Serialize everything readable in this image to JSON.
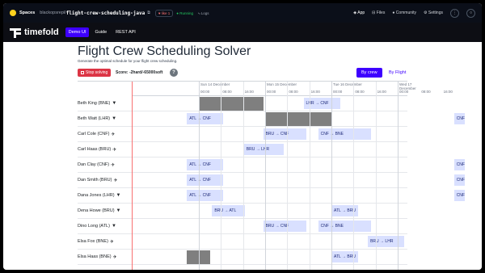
{
  "hf": {
    "spaces": "Spaces",
    "owner": "blackopsrepl/",
    "repo": "flight-crew-scheduling-java",
    "like": "♥ like 1",
    "status": "● Running",
    "logs": "⤷ Logs",
    "nav": [
      "App",
      "Files",
      "Community",
      "Settings"
    ]
  },
  "timefold": {
    "brand": "timefold",
    "nav": [
      "Demo UI",
      "Guide",
      "REST API"
    ]
  },
  "page": {
    "title": "Flight Crew Scheduling Solver",
    "subtitle": "Generate the optimal schedule for your flight crew scheduling.",
    "stop_label": "Stop solving",
    "score": "Score: -2hard/-65000soft",
    "info": "?",
    "by_crew": "By crew",
    "by_flight": "By Flight"
  },
  "timeline": {
    "days": [
      "Sun 14 December",
      "Mon 15 December",
      "Tue 16 December",
      "Wed 17 December"
    ],
    "hours": [
      "00:00",
      "08:00",
      "16:00",
      "00:00",
      "08:00",
      "16:00",
      "00:00",
      "08:00",
      "16:00",
      "00:00",
      "08:00",
      "16:00"
    ],
    "rows": [
      {
        "name": "Beth King (BNE)",
        "icon": "pilot-icon",
        "grays": [
          [
            0.0,
            0.97
          ]
        ],
        "flights": [
          [
            1.58,
            0.55,
            "LHR → CNF"
          ]
        ]
      },
      {
        "name": "Beth Watt (LHR)",
        "icon": "pilot-icon",
        "grays": [
          [
            1.0,
            2.0
          ]
        ],
        "flights": [
          [
            -0.18,
            0.55,
            "ATL → CNF"
          ],
          [
            3.85,
            0.55,
            "CNF"
          ]
        ]
      },
      {
        "name": "Carl Cole (CNF)",
        "icon": "attendant-icon",
        "grays": [],
        "flights": [
          [
            0.97,
            0.65,
            "BRU → CNF"
          ],
          [
            1.8,
            0.8,
            "CNF → BNE"
          ]
        ]
      },
      {
        "name": "Carl Haas (BRU)",
        "icon": "attendant-icon",
        "grays": [],
        "flights": [
          [
            0.68,
            0.6,
            "BRU → LHR"
          ]
        ]
      },
      {
        "name": "Dan Clay (CNF)",
        "icon": "attendant-icon",
        "grays": [],
        "flights": [
          [
            -0.18,
            0.55,
            "ATL → CNF"
          ],
          [
            3.85,
            0.55,
            "CNF"
          ]
        ]
      },
      {
        "name": "Dan Smith (BRU)",
        "icon": "attendant-icon",
        "grays": [],
        "flights": [
          [
            -0.18,
            0.55,
            "ATL → CNF"
          ],
          [
            3.85,
            0.55,
            "CNF"
          ]
        ]
      },
      {
        "name": "Dana Jones (LHR)",
        "icon": "pilot-icon",
        "grays": [],
        "flights": [
          [
            -0.18,
            0.55,
            "ATL → CNF"
          ],
          [
            3.85,
            0.55,
            "CNF"
          ]
        ]
      },
      {
        "name": "Dena Howe (BRU)",
        "icon": "pilot-icon",
        "grays": [],
        "flights": [
          [
            0.2,
            0.5,
            "BRU → ATL"
          ],
          [
            2.0,
            0.4,
            "ATL → BRU"
          ]
        ]
      },
      {
        "name": "Dino Long (ATL)",
        "icon": "pilot-icon",
        "grays": [],
        "flights": [
          [
            0.97,
            0.65,
            "BRU → CNF"
          ],
          [
            1.8,
            0.8,
            "CNF → BNE"
          ]
        ]
      },
      {
        "name": "Elsa Fox (BNE)",
        "icon": "attendant-icon",
        "grays": [],
        "flights": [
          [
            2.55,
            0.55,
            "BRU → LHR"
          ]
        ]
      },
      {
        "name": "Elsa Haas (BNE)",
        "icon": "attendant-icon",
        "grays": [
          [
            -0.18,
            0.17
          ]
        ],
        "flights": [
          [
            2.0,
            0.4,
            "ATL → BRU"
          ]
        ]
      },
      {
        "name": "",
        "icon": "pilot-icon",
        "grays": [],
        "flights": []
      }
    ]
  },
  "colors": {
    "accent": "#3e00ff",
    "stop": "#dc3545",
    "flight": "#d9e0ff",
    "unavailable": "#7f7f7f"
  }
}
